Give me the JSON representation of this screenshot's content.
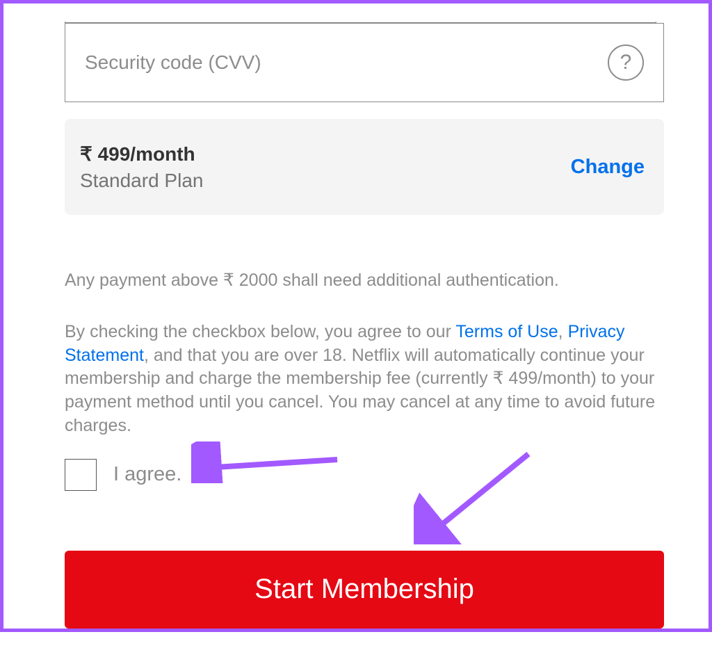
{
  "cvv": {
    "placeholder": "Security code (CVV)",
    "help_symbol": "?"
  },
  "plan": {
    "price": "₹ 499/month",
    "name": "Standard Plan",
    "change_label": "Change"
  },
  "notice": "Any payment above ₹ 2000 shall need additional authentication.",
  "legal": {
    "prefix": "By checking the checkbox below, you agree to our ",
    "terms_label": "Terms of Use",
    "separator1": ", ",
    "privacy_label": "Privacy Statement",
    "suffix": ", and that you are over 18. Netflix will automatically continue your membership and charge the membership fee (currently ₹ 499/month) to your payment method until you cancel. You may cancel at any time to avoid future charges."
  },
  "agree": {
    "label": "I agree."
  },
  "cta": {
    "label": "Start Membership"
  },
  "colors": {
    "accent_red": "#e50914",
    "link_blue": "#0071eb",
    "frame_purple": "#a259ff",
    "arrow_purple": "#a259ff"
  }
}
